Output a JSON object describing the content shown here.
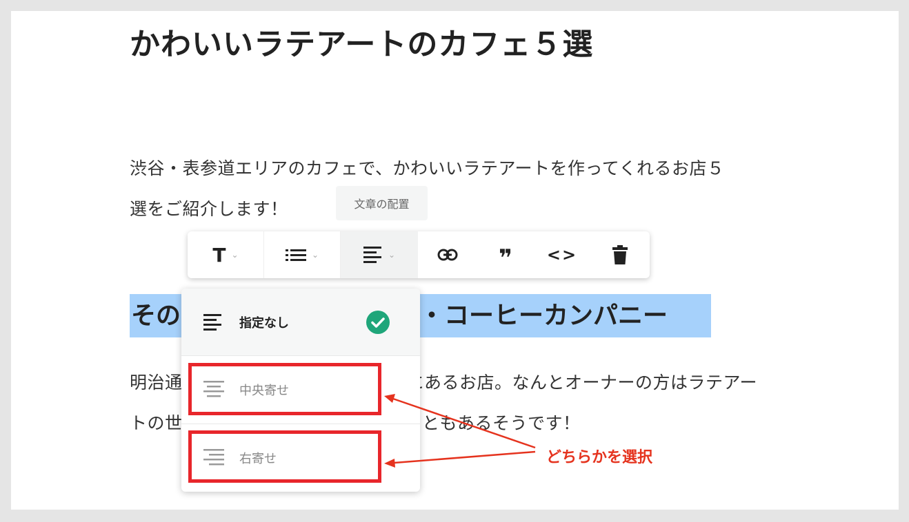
{
  "article": {
    "title": "かわいいラテアートのカフェ５選",
    "intro_line1": "渋谷・表参道エリアのカフェで、かわいいラテアートを作ってくれるお店５",
    "intro_line2": "選をご紹介します！",
    "heading_start": "その",
    "heading_end": "・コーヒーカンパニー",
    "body_line1_start": "明治通",
    "body_line1_end": "らにあるお店。なんとオーナーの方はラテアー",
    "body_line2_start": "トの世",
    "body_line2_end": "ともあるそうです！"
  },
  "tooltip": {
    "label": "文章の配置"
  },
  "toolbar": {
    "text_style_glyph": "T",
    "quote_glyph": "❞",
    "code_glyph": "<>",
    "caret": "⌄"
  },
  "align_menu": {
    "items": [
      {
        "label": "指定なし",
        "selected": true,
        "icon": "align-left-icon"
      },
      {
        "label": "中央寄せ",
        "selected": false,
        "icon": "align-center-icon"
      },
      {
        "label": "右寄せ",
        "selected": false,
        "icon": "align-right-icon"
      }
    ]
  },
  "annotation": {
    "label": "どちらかを選択",
    "color": "#e5331e"
  },
  "colors": {
    "selection_highlight": "#a6d1fb",
    "check_green": "#1fa67a",
    "annotation_red": "#e8262b"
  }
}
